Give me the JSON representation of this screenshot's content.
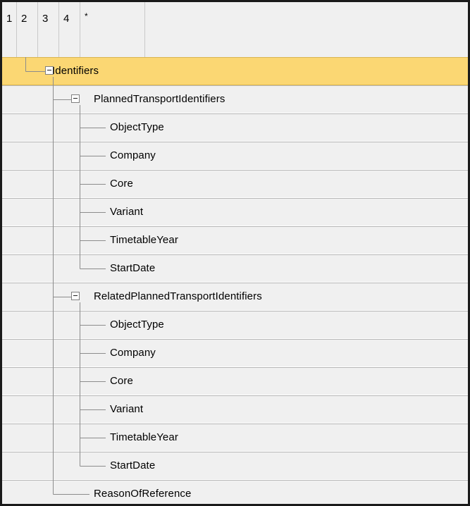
{
  "outline_levels": [
    "1",
    "2",
    "3",
    "4",
    "*"
  ],
  "tree": [
    {
      "label": "Identifiers",
      "depth": 1,
      "expander": true,
      "selected": true
    },
    {
      "label": "PlannedTransportIdentifiers",
      "depth": 2,
      "expander": true
    },
    {
      "label": "ObjectType",
      "depth": 3
    },
    {
      "label": "Company",
      "depth": 3
    },
    {
      "label": "Core",
      "depth": 3
    },
    {
      "label": "Variant",
      "depth": 3
    },
    {
      "label": "TimetableYear",
      "depth": 3
    },
    {
      "label": "StartDate",
      "depth": 3
    },
    {
      "label": "RelatedPlannedTransportIdentifiers",
      "depth": 2,
      "expander": true
    },
    {
      "label": "ObjectType",
      "depth": 3
    },
    {
      "label": "Company",
      "depth": 3
    },
    {
      "label": "Core",
      "depth": 3
    },
    {
      "label": "Variant",
      "depth": 3
    },
    {
      "label": "TimetableYear",
      "depth": 3
    },
    {
      "label": "StartDate",
      "depth": 3
    },
    {
      "label": "ReasonOfReference",
      "depth": 2
    }
  ],
  "colors": {
    "selected_row": "#fbd773",
    "background": "#f0f0f0",
    "tree_line": "#8c8c8c"
  }
}
